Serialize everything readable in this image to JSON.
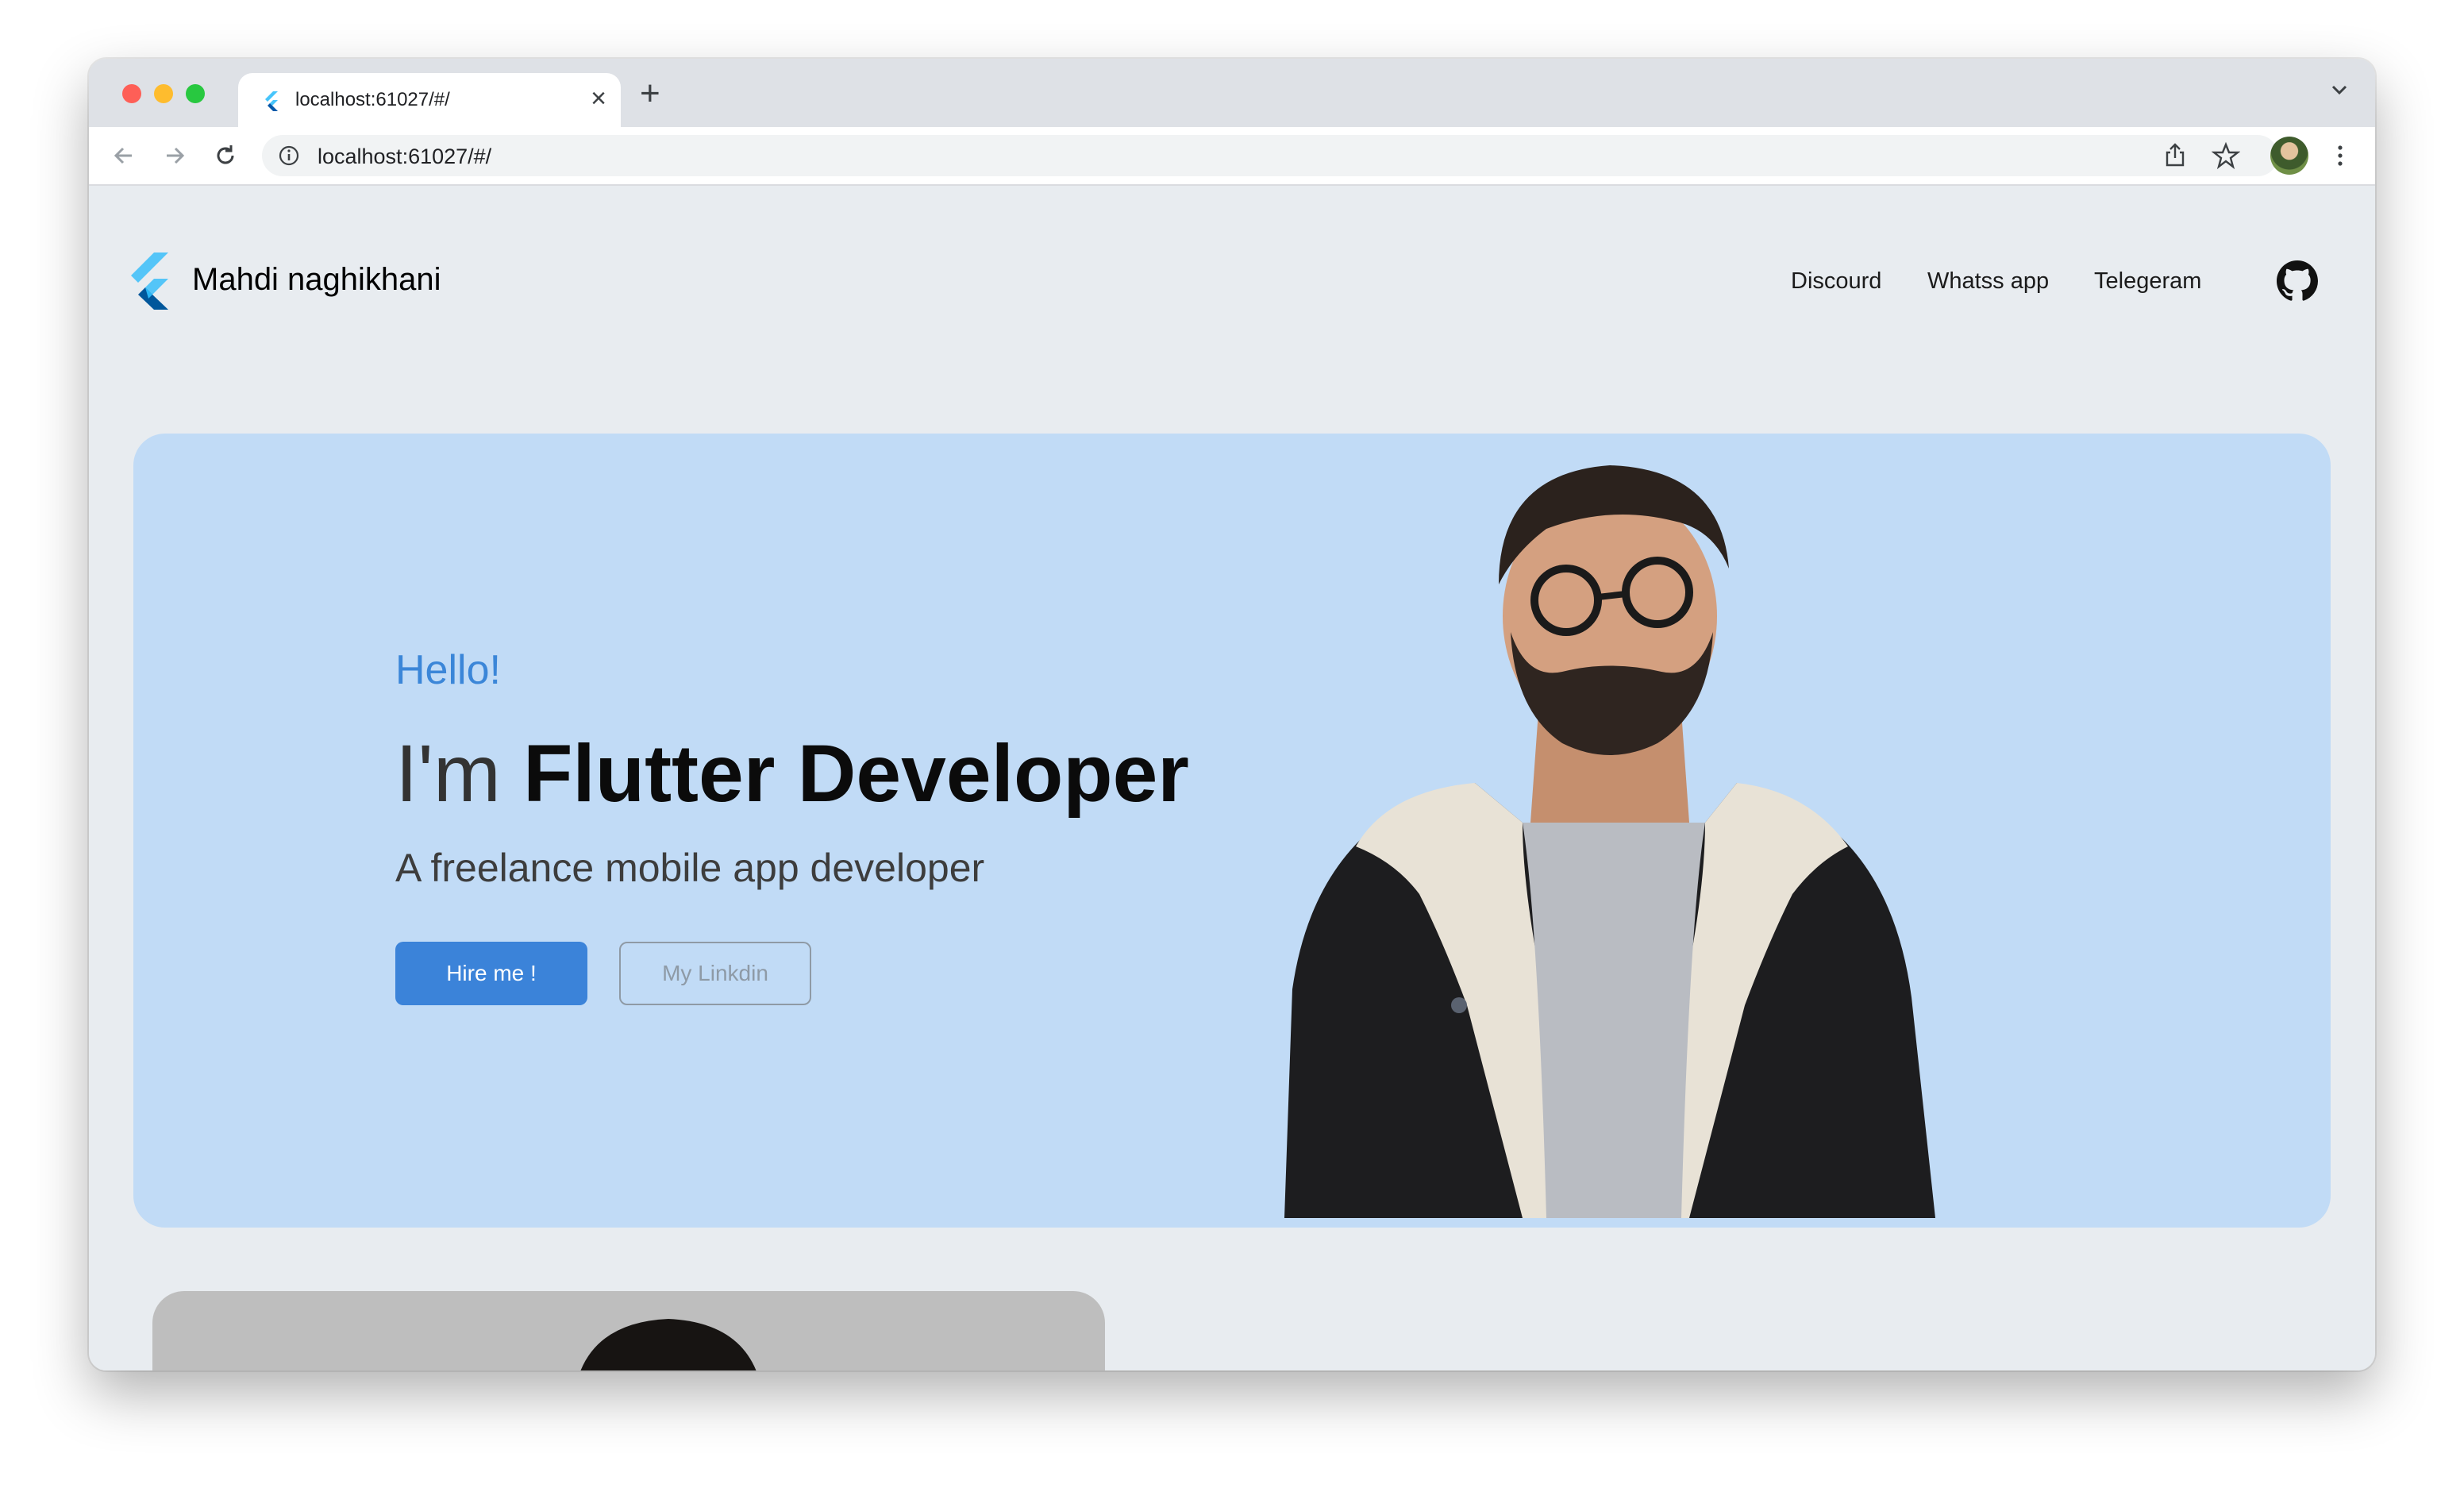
{
  "browser": {
    "tab_title": "localhost:61027/#/",
    "url": "localhost:61027/#/",
    "close_glyph": "×",
    "new_tab_glyph": "+"
  },
  "site": {
    "brand": "Mahdi naghikhani",
    "nav": [
      {
        "label": "Discourd"
      },
      {
        "label": "Whatss app"
      },
      {
        "label": "Telegeram"
      }
    ],
    "github_icon": "github-icon"
  },
  "hero": {
    "greeting": "Hello!",
    "headline_prefix": "I'm ",
    "headline_role": "Flutter Developer",
    "subtitle": "A freelance mobile app developer",
    "primary_button": "Hire me !",
    "secondary_button": "My Linkdin"
  },
  "colors": {
    "accent": "#3b83d9",
    "hero_bg": "#c1dbf6",
    "page_bg": "#e8ecf0"
  }
}
